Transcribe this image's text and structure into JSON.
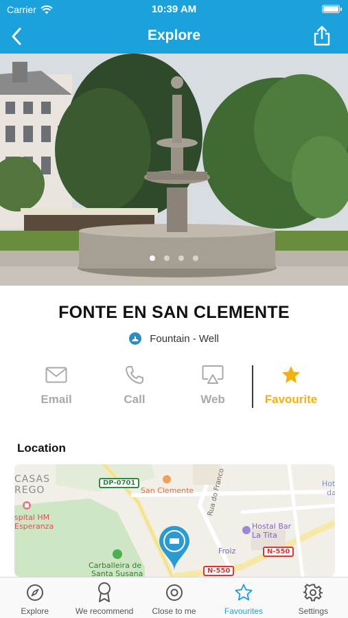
{
  "status": {
    "carrier": "Carrier",
    "time": "10:39 AM"
  },
  "nav": {
    "title": "Explore"
  },
  "hero": {
    "slide_count": 4,
    "active_slide": 1
  },
  "place": {
    "title": "FONTE EN SAN CLEMENTE",
    "category": "Fountain - Well"
  },
  "actions": {
    "email": "Email",
    "call": "Call",
    "web": "Web",
    "favourite": "Favourite"
  },
  "location": {
    "title": "Location",
    "map_labels": {
      "casas": "CASAS",
      "rego": "REGO",
      "dp": "DP-0701",
      "san_clemente": "San Clemente",
      "rua_franco": "Rua do Franco",
      "hot": "Hot",
      "da": "da",
      "hospital_1": "spital HM",
      "hospital_2": "Esperanza",
      "hostal_1": "Hostal Bar",
      "hostal_2": "La Tita",
      "froiz": "Froiz",
      "n550a": "N-550",
      "n550b": "N-550",
      "carballeira_1": "Carballeira de",
      "carballeira_2": "Santa Susana"
    }
  },
  "tabs": [
    {
      "label": "Explore",
      "icon": "compass-icon"
    },
    {
      "label": "We recommend",
      "icon": "award-icon"
    },
    {
      "label": "Close to me",
      "icon": "target-icon"
    },
    {
      "label": "Favourites",
      "icon": "star-icon"
    },
    {
      "label": "Settings",
      "icon": "gear-icon"
    }
  ],
  "colors": {
    "primary": "#1ba2dd",
    "favourite": "#f2b111",
    "muted": "#a9a9a9"
  }
}
